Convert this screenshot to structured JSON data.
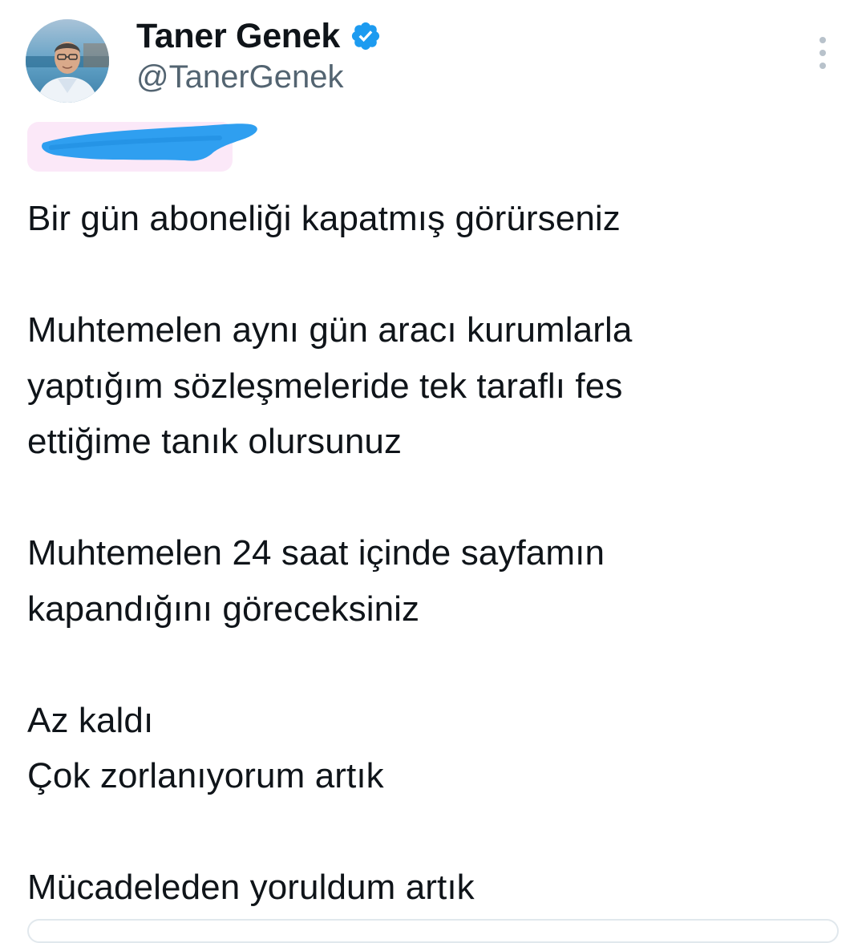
{
  "author": {
    "display_name": "Taner Genek",
    "handle": "@TanerGenek",
    "verified": true,
    "avatar_icon": "profile-photo"
  },
  "actions": {
    "more_icon": "more-vertical-icon"
  },
  "redacted_region": {
    "description_icon": "redaction-scribble",
    "color": "#2f9ff0"
  },
  "tweet": {
    "paragraphs": [
      [
        "Bir gün aboneliği kapatmış görürseniz"
      ],
      [
        "Muhtemelen aynı gün aracı kurumlarla",
        "yaptığım sözleşmeleride tek taraflı fes",
        "ettiğime tanık olursunuz"
      ],
      [
        "Muhtemelen 24 saat içinde sayfamın",
        "kapandığını göreceksiniz"
      ],
      [
        "Az kaldı",
        "Çok zorlanıyorum artık"
      ],
      [
        "Mücadeleden yoruldum artık"
      ]
    ]
  },
  "colors": {
    "verified_badge": "#1d9bf0",
    "handle_text": "#536471",
    "body_text": "#0f1419"
  }
}
